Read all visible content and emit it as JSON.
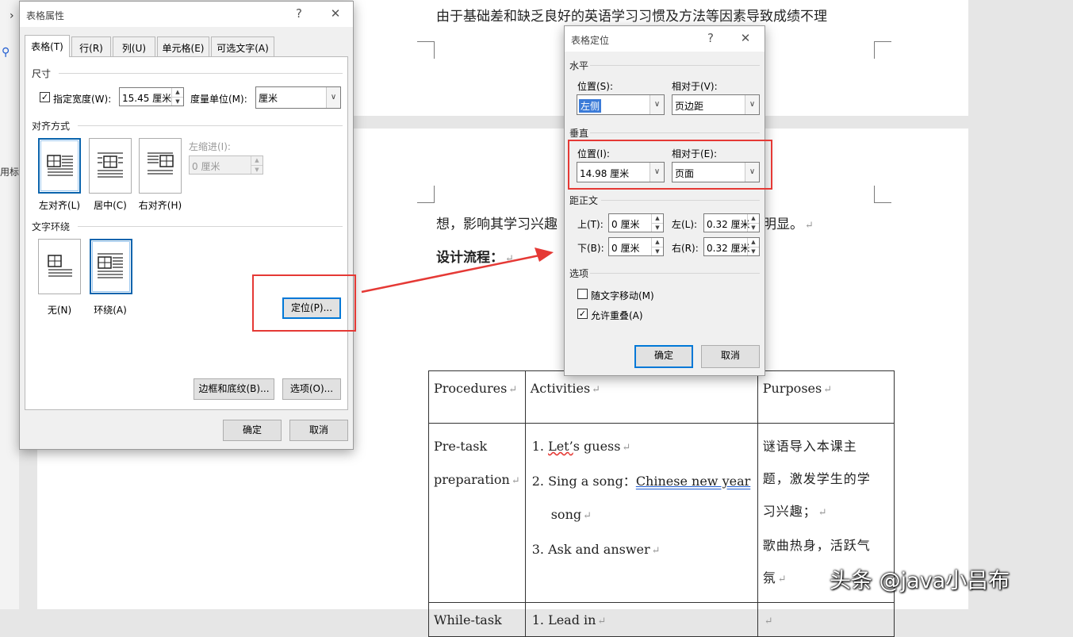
{
  "document": {
    "line1": "由于基础差和缺乏良好的英语学习习惯及方法等因素导致成绩不理",
    "line2_left": "想，影响其学习兴趣",
    "line2_right": "明显。",
    "heading": "设计流程：",
    "left_partial_text": "用标",
    "paragraph_mark": "↵",
    "table": {
      "headers": [
        "Procedures",
        "Activities",
        "Purposes"
      ],
      "row1": {
        "procedure_line1": "Pre-task",
        "procedure_line2": "preparation",
        "act1_num": "1.",
        "act1_a": "Let",
        "act1_b": "’",
        "act1_c": "s",
        "act1_d": "guess",
        "act2_num": "2.",
        "act2_a": "Sing a song：",
        "act2_link": "Chinese new year",
        "act2_b": "song",
        "act3_num": "3.",
        "act3": "Ask and answer",
        "purpose_lines": [
          "谜语导入本课主",
          "题，激发学生的学",
          "习兴趣；",
          "歌曲热身，活跃气",
          "氛"
        ]
      },
      "row2": {
        "procedure": "While-task",
        "activity": "1. Lead in"
      }
    }
  },
  "table_props_dialog": {
    "title": "表格属性",
    "help": "?",
    "close": "✕",
    "tabs": [
      "表格(T)",
      "行(R)",
      "列(U)",
      "单元格(E)",
      "可选文字(A)"
    ],
    "size_section": "尺寸",
    "preferred_width_label": "指定宽度(W):",
    "preferred_width_checked": true,
    "width_value": "15.45 厘米",
    "measure_label": "度量单位(M):",
    "measure_value": "厘米",
    "alignment_section": "对齐方式",
    "align_options": [
      "左对齐(L)",
      "居中(C)",
      "右对齐(H)"
    ],
    "indent_label": "左缩进(I):",
    "indent_value": "0 厘米",
    "wrap_section": "文字环绕",
    "wrap_options": [
      "无(N)",
      "环绕(A)"
    ],
    "positioning_button": "定位(P)...",
    "borders_button": "边框和底纹(B)...",
    "options_button": "选项(O)...",
    "ok": "确定",
    "cancel": "取消"
  },
  "table_position_dialog": {
    "title": "表格定位",
    "help": "?",
    "close": "✕",
    "horizontal_section": "水平",
    "h_position_label": "位置(S):",
    "h_position_value": "左侧",
    "h_relative_label": "相对于(V):",
    "h_relative_value": "页边距",
    "vertical_section": "垂直",
    "v_position_label": "位置(I):",
    "v_position_value": "14.98 厘米",
    "v_relative_label": "相对于(E):",
    "v_relative_value": "页面",
    "distance_section": "距正文",
    "top_label": "上(T):",
    "top_value": "0 厘米",
    "bottom_label": "下(B):",
    "bottom_value": "0 厘米",
    "left_label": "左(L):",
    "left_value": "0.32 厘米",
    "right_label": "右(R):",
    "right_value": "0.32 厘米",
    "options_section": "选项",
    "move_with_text_label": "随文字移动(M)",
    "move_with_text_checked": false,
    "allow_overlap_label": "允许重叠(A)",
    "allow_overlap_checked": true,
    "ok": "确定",
    "cancel": "取消"
  },
  "toolbar_fragments": {
    "chevron": "›",
    "search_glyph": "⚲"
  },
  "watermark": "头条 @java小吕布",
  "annotation_color": "#e53935",
  "accent_color": "#0078d7"
}
